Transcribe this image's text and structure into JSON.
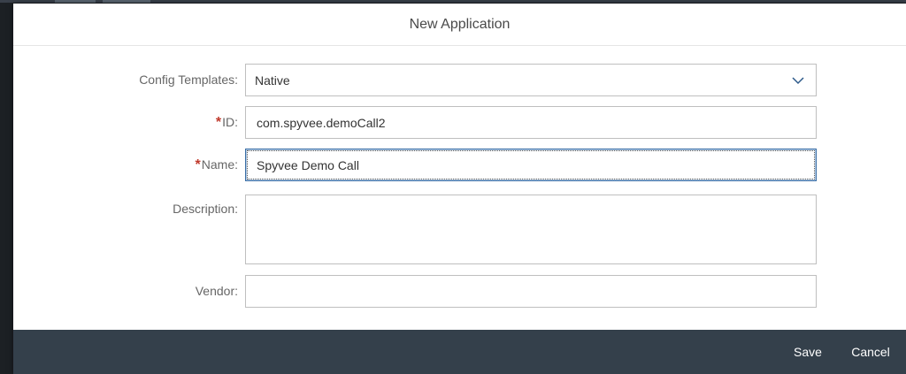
{
  "dialog": {
    "title": "New Application"
  },
  "form": {
    "config_templates": {
      "label": "Config Templates:",
      "value": "Native"
    },
    "id": {
      "required_mark": "*",
      "label": "ID:",
      "value": "com.spyvee.demoCall2"
    },
    "name": {
      "required_mark": "*",
      "label": "Name:",
      "value": "Spyvee Demo Call"
    },
    "description": {
      "label": "Description:",
      "value": ""
    },
    "vendor": {
      "label": "Vendor:",
      "value": ""
    }
  },
  "footer": {
    "save_label": "Save",
    "cancel_label": "Cancel"
  },
  "icons": {
    "select_chevron": "chevron-down-icon"
  },
  "colors": {
    "footer_bg": "#34404b",
    "required": "#c0392b",
    "focus_border": "#3a6ea5"
  }
}
